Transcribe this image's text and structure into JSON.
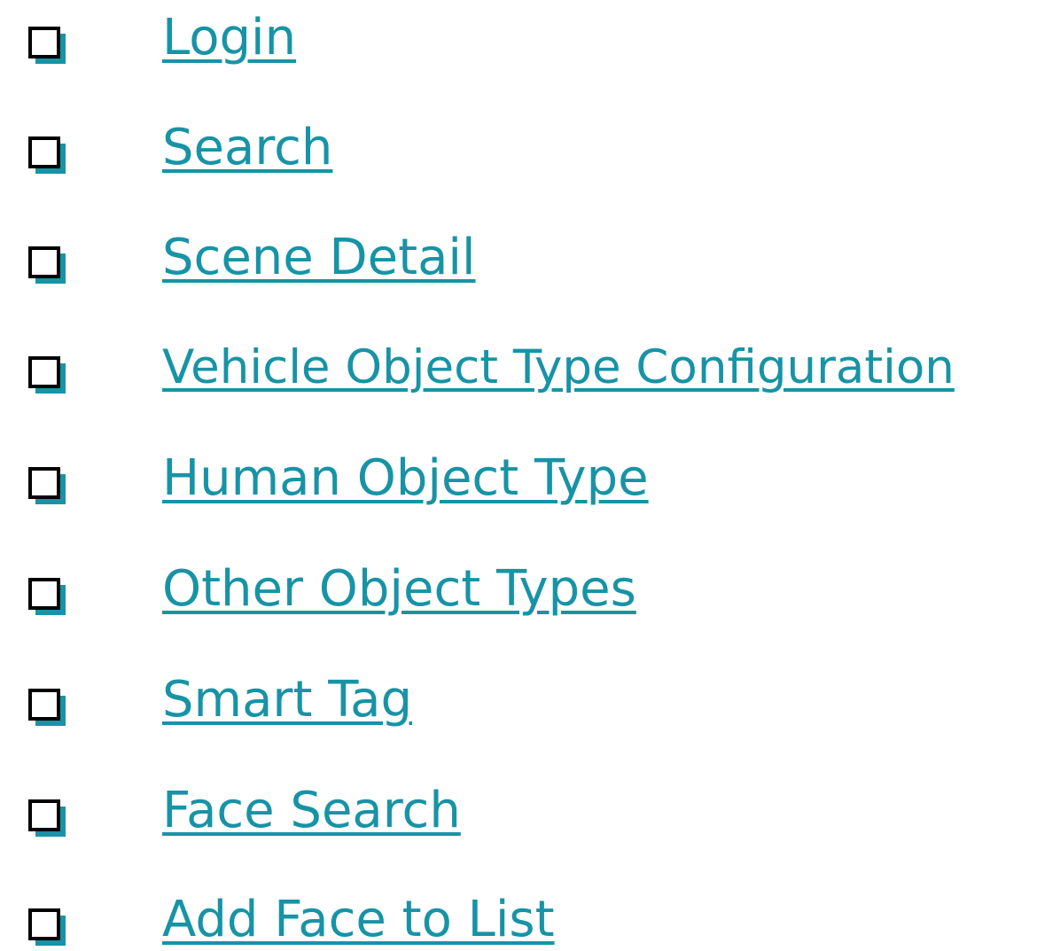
{
  "checklist": {
    "items": [
      {
        "label": "Login"
      },
      {
        "label": "Search"
      },
      {
        "label": "Scene Detail"
      },
      {
        "label": "Vehicle Object Type Configuration"
      },
      {
        "label": "Human Object Type"
      },
      {
        "label": "Other Object Types"
      },
      {
        "label": "Smart Tag"
      },
      {
        "label": "Face Search"
      },
      {
        "label": "Add Face to List"
      }
    ],
    "bullet_icon": "shadowed-box-icon",
    "colors": {
      "link": "#1893a6",
      "bullet_outline": "#000000",
      "bullet_shadow": "#1893a6"
    }
  }
}
